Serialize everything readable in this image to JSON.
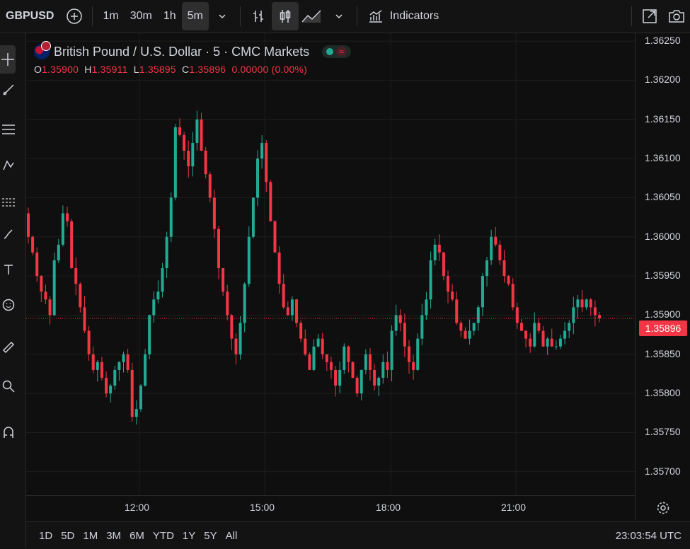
{
  "toolbar": {
    "symbol": "GBPUSD",
    "timeframes": [
      "1m",
      "30m",
      "1h",
      "5m"
    ],
    "active_timeframe": "5m",
    "indicators_label": "Indicators"
  },
  "legend": {
    "title": "British Pound / U.S. Dollar · 5 · CMC Markets",
    "o_label": "O",
    "o_value": "1.35900",
    "h_label": "H",
    "h_value": "1.35911",
    "l_label": "L",
    "l_value": "1.35895",
    "c_label": "C",
    "c_value": "1.35896",
    "change": "0.00000 (0.00%)"
  },
  "price_axis": {
    "labels": [
      "1.36250",
      "1.36200",
      "1.36150",
      "1.36100",
      "1.36050",
      "1.36000",
      "1.35950",
      "1.35900",
      "1.35850",
      "1.35800",
      "1.35750",
      "1.35700"
    ],
    "current_price": "1.35896"
  },
  "time_axis": {
    "labels": [
      "12:00",
      "15:00",
      "18:00",
      "21:00"
    ]
  },
  "bottom": {
    "ranges": [
      "1D",
      "5D",
      "1M",
      "3M",
      "6M",
      "YTD",
      "1Y",
      "5Y",
      "All"
    ],
    "clock": "23:03:54 UTC"
  },
  "colors": {
    "up": "#22ab94",
    "down": "#f23645",
    "background": "#0f0f0f"
  },
  "chart_data": {
    "type": "candlestick",
    "title": "British Pound / U.S. Dollar · 5 · CMC Markets",
    "ylim": [
      1.3567,
      1.3626
    ],
    "x_ticks": [
      "12:00",
      "15:00",
      "18:00",
      "21:00"
    ],
    "last_price": 1.35896,
    "closes": [
      1.36,
      1.3598,
      1.3595,
      1.3593,
      1.3592,
      1.359,
      1.3597,
      1.3599,
      1.3603,
      1.3602,
      1.3596,
      1.3594,
      1.3591,
      1.3588,
      1.3585,
      1.3583,
      1.3584,
      1.3582,
      1.358,
      1.3581,
      1.3583,
      1.3584,
      1.3585,
      1.3583,
      1.3577,
      1.3578,
      1.3581,
      1.3585,
      1.359,
      1.3592,
      1.3593,
      1.3596,
      1.36,
      1.3605,
      1.3614,
      1.3613,
      1.3611,
      1.3609,
      1.3612,
      1.3615,
      1.3611,
      1.3608,
      1.3605,
      1.3601,
      1.3596,
      1.3593,
      1.359,
      1.3587,
      1.3585,
      1.3589,
      1.3594,
      1.36,
      1.3605,
      1.361,
      1.3612,
      1.3607,
      1.3602,
      1.3598,
      1.3594,
      1.3591,
      1.359,
      1.3592,
      1.3589,
      1.3587,
      1.3585,
      1.3583,
      1.3586,
      1.3587,
      1.3585,
      1.3584,
      1.3583,
      1.3581,
      1.3583,
      1.3586,
      1.3584,
      1.3582,
      1.358,
      1.3583,
      1.3585,
      1.3583,
      1.3581,
      1.3582,
      1.3584,
      1.3583,
      1.3588,
      1.359,
      1.3589,
      1.3586,
      1.3584,
      1.3583,
      1.3587,
      1.359,
      1.3592,
      1.3597,
      1.3599,
      1.3598,
      1.3595,
      1.3593,
      1.3592,
      1.3589,
      1.3588,
      1.3587,
      1.3588,
      1.3589,
      1.3591,
      1.3595,
      1.3597,
      1.36,
      1.3599,
      1.3597,
      1.3595,
      1.3594,
      1.3591,
      1.3589,
      1.3588,
      1.3587,
      1.3586,
      1.3589,
      1.3588,
      1.3586,
      1.3587,
      1.3586,
      1.3586,
      1.3587,
      1.3588,
      1.3589,
      1.3591,
      1.3592,
      1.3591,
      1.3592,
      1.3591,
      1.359,
      1.35896
    ]
  }
}
